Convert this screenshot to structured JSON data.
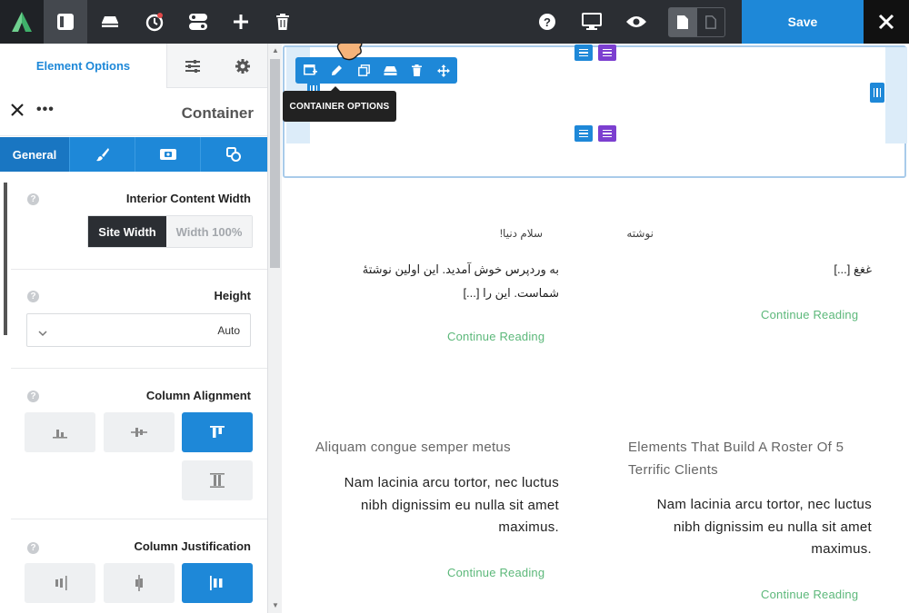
{
  "topbar": {
    "logo_icon": "brand-logo-icon",
    "tools": [
      "layout-icon",
      "sections-icon",
      "history-icon",
      "templates-icon",
      "add-icon",
      "trash-icon"
    ],
    "help_icon": "help-icon",
    "desktop_icon": "desktop-icon",
    "preview_icon": "eye-icon",
    "save_label": "Save",
    "close_icon": "close-icon"
  },
  "panel": {
    "main_tab": "Element Options",
    "crumb_title": "Container",
    "more": "•••",
    "subtabs": {
      "general": "General"
    },
    "interior_width": {
      "label": "Interior Content Width",
      "options": [
        "Site Width",
        "Width 100%"
      ],
      "selected": "Site Width"
    },
    "height": {
      "label": "Height",
      "value": "Auto"
    },
    "column_alignment": {
      "label": "Column Alignment",
      "selected": "top"
    },
    "column_justification": {
      "label": "Column Justification",
      "selected": "start"
    },
    "help_glyph": "?"
  },
  "canvas": {
    "tooltip": "CONTAINER OPTIONS",
    "posts": [
      {
        "title": "سلام دنیا!",
        "excerpt": "به وردپرس خوش آمدید. این اولین نوشتهٔ شماست. این را [...]",
        "more": "Continue Reading"
      },
      {
        "title": "نوشته",
        "excerpt": "غغغ [...]",
        "more": "Continue Reading"
      },
      {
        "title": "Aliquam congue semper metus",
        "excerpt": "Nam lacinia arcu tortor, nec luctus nibh dignissim eu nulla sit amet maximus.",
        "more": "Continue Reading"
      },
      {
        "title": "Elements That Build A Roster Of 5 Terrific Clients",
        "excerpt": "Nam lacinia arcu tortor, nec luctus nibh dignissim eu nulla sit amet maximus.",
        "more": "Continue Reading"
      }
    ]
  },
  "colors": {
    "accent": "#1e88d8",
    "green": "#5cb87a",
    "purple": "#7c3fd0",
    "dark": "#2b2e33"
  }
}
